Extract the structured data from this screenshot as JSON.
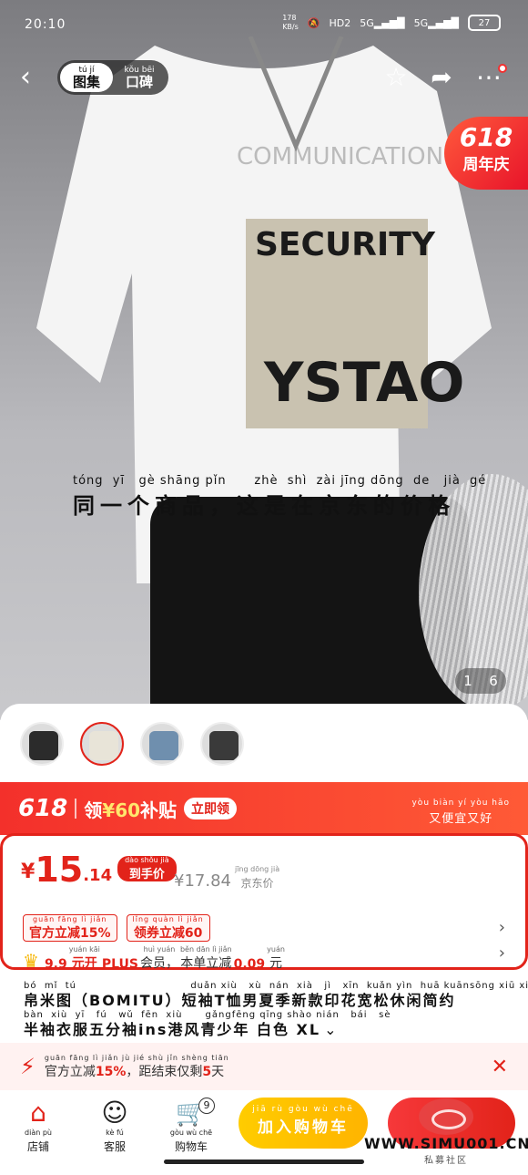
{
  "status_bar": {
    "time": "20:10",
    "net_speed": "178\nKB/s",
    "hd": "HD2",
    "sig1": "5G",
    "sig2": "5G",
    "battery": "27"
  },
  "top_nav": {
    "tab_image": "图集",
    "tab_image_py": "tú jí",
    "tab_review": "口碑",
    "tab_review_py": "kǒu bēi"
  },
  "badge": {
    "num": "618",
    "text": "周年庆"
  },
  "overlay_caption": {
    "pinyin": "tóng  yī   gè shāng pǐn      zhè  shì  zài jīng dōng  de   jià  gé",
    "text": "同一个商品，这是在京东的价格"
  },
  "image_counter": {
    "current": "1",
    "total": "6"
  },
  "promo": {
    "num": "618",
    "prefix": "领",
    "amount": "¥60",
    "suffix": "补贴",
    "claim": "立即领",
    "right_py": "yòu biàn  yí  yòu hǎo",
    "right_zh": "又便宜又好"
  },
  "price": {
    "yen": "¥",
    "int": "15",
    "dec": ".14",
    "hand_py": "dào shǒu jià",
    "hand_zh": "到手价",
    "jd_val": "¥17.84",
    "jd_py": "jīng dōng  jià",
    "jd_zh": "京东价"
  },
  "coupons": [
    {
      "py": "guān fāng   lì   jiǎn",
      "zh": "官方立减15%"
    },
    {
      "py": "lǐng quàn  lì   jiǎn",
      "zh": "领券立减60"
    }
  ],
  "plus": {
    "amount": "9.9",
    "amount_py": "yuán kāi",
    "mid": "元开",
    "plus": "PLUS",
    "member_py": "huì yuán",
    "member": "会员，",
    "save_py": "běn dān  lì  jiǎn",
    "save": "本单立减",
    "save_amt": "0.09",
    "unit_py": "yuán",
    "unit": "元"
  },
  "title": {
    "py1": "bó  mǐ  tú                              duǎn xiù   xù  nán  xià   jì   xīn  kuǎn yìn  huā kuānsōng xiū xián jiǎn yuē",
    "zh1": "帛米图（BOMITU）短袖T恤男夏季新款印花宽松休闲简约",
    "py2": "bàn  xiù  yī   fú   wǔ  fēn  xiù      gǎngfēng qīng shào nián   bái   sè",
    "zh2": "半袖衣服五分袖ins港风青少年 白色 XL",
    "chev": "⌄"
  },
  "countdown": {
    "py": "guān fāng  lì  jiǎn                jù   jié  shù  jǐn shèng      tiān",
    "prefix": "官方立减",
    "pct": "15%",
    "mid": "，距结束仅剩",
    "days": "5",
    "unit": "天"
  },
  "bottom_bar": {
    "shop_py": "diàn pù",
    "shop": "店铺",
    "service_py": "kè  fú",
    "service": "客服",
    "cart_py": "gòu  wù  chē",
    "cart": "购物车",
    "cart_count": "9",
    "add_py": "jiā  rù  gòu  wù  chē",
    "add": "加入购物车"
  },
  "watermark": {
    "url": "WWW.SIMU001.CN",
    "sub": "私募社区"
  },
  "colors": {
    "accent": "#e2231a",
    "gold": "#ffcc00"
  }
}
